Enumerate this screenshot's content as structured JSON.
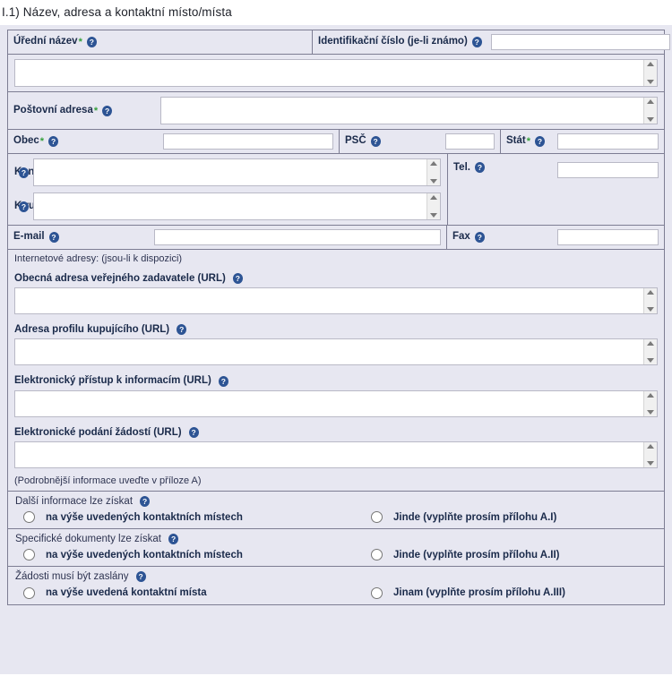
{
  "section": {
    "title": "I.1) Název, adresa a kontaktní místo/místa"
  },
  "icons": {
    "help": "?",
    "required": "*"
  },
  "colors": {
    "page_background": "#e7e7f1",
    "border": "#7d7d93",
    "label_text": "#1a2a4a",
    "help_icon": "#2d5494",
    "required_marker": "#35a03a",
    "input_background": "#ffffff",
    "input_border": "#b9b9c6"
  },
  "fields": {
    "official_name": {
      "label": "Úřední název",
      "required": true,
      "value": ""
    },
    "identification_number": {
      "label": "Identifikační číslo (je-li známo)",
      "required": false,
      "value": ""
    },
    "postal_address": {
      "label": "Poštovní adresa",
      "required": true,
      "value": ""
    },
    "city": {
      "label": "Obec",
      "required": true,
      "value": ""
    },
    "postal_code": {
      "label": "PSČ",
      "required": false,
      "value": ""
    },
    "state": {
      "label": "Stát",
      "required": true,
      "value": ""
    },
    "contact_points": {
      "label": "Kontaktní místa",
      "required": false,
      "value": ""
    },
    "attention": {
      "label": "K rukám",
      "required": false,
      "value": ""
    },
    "phone": {
      "label": "Tel.",
      "required": false,
      "value": ""
    },
    "email": {
      "label": "E-mail",
      "required": false,
      "value": ""
    },
    "fax": {
      "label": "Fax",
      "required": false,
      "value": ""
    }
  },
  "internet": {
    "heading": "Internetové adresy: (jsou-li k dispozici)",
    "urls": [
      {
        "label": "Obecná adresa veřejného zadavatele (URL)",
        "value": ""
      },
      {
        "label": "Adresa profilu kupujícího (URL)",
        "value": ""
      },
      {
        "label": "Elektronický přístup k informacím (URL)",
        "value": ""
      },
      {
        "label": "Elektronické podání žádostí (URL)",
        "value": ""
      }
    ],
    "footnote": "(Podrobnější informace uveďte v příloze A)"
  },
  "radio_groups": [
    {
      "heading": "Další informace lze získat",
      "name": "further-information",
      "options": [
        {
          "label": "na výše uvedených kontaktních místech",
          "checked": false
        },
        {
          "label": "Jinde (vyplňte prosím přílohu A.I)",
          "checked": false
        }
      ]
    },
    {
      "heading": "Specifické dokumenty lze získat",
      "name": "specific-documents",
      "options": [
        {
          "label": "na výše uvedených kontaktních místech",
          "checked": false
        },
        {
          "label": "Jinde (vyplňte prosím přílohu A.II)",
          "checked": false
        }
      ]
    },
    {
      "heading": "Žádosti musí být zaslány",
      "name": "applications-sent-to",
      "options": [
        {
          "label": "na výše uvedená kontaktní místa",
          "checked": false
        },
        {
          "label": "Jinam (vyplňte prosím přílohu A.III)",
          "checked": false
        }
      ]
    }
  ]
}
